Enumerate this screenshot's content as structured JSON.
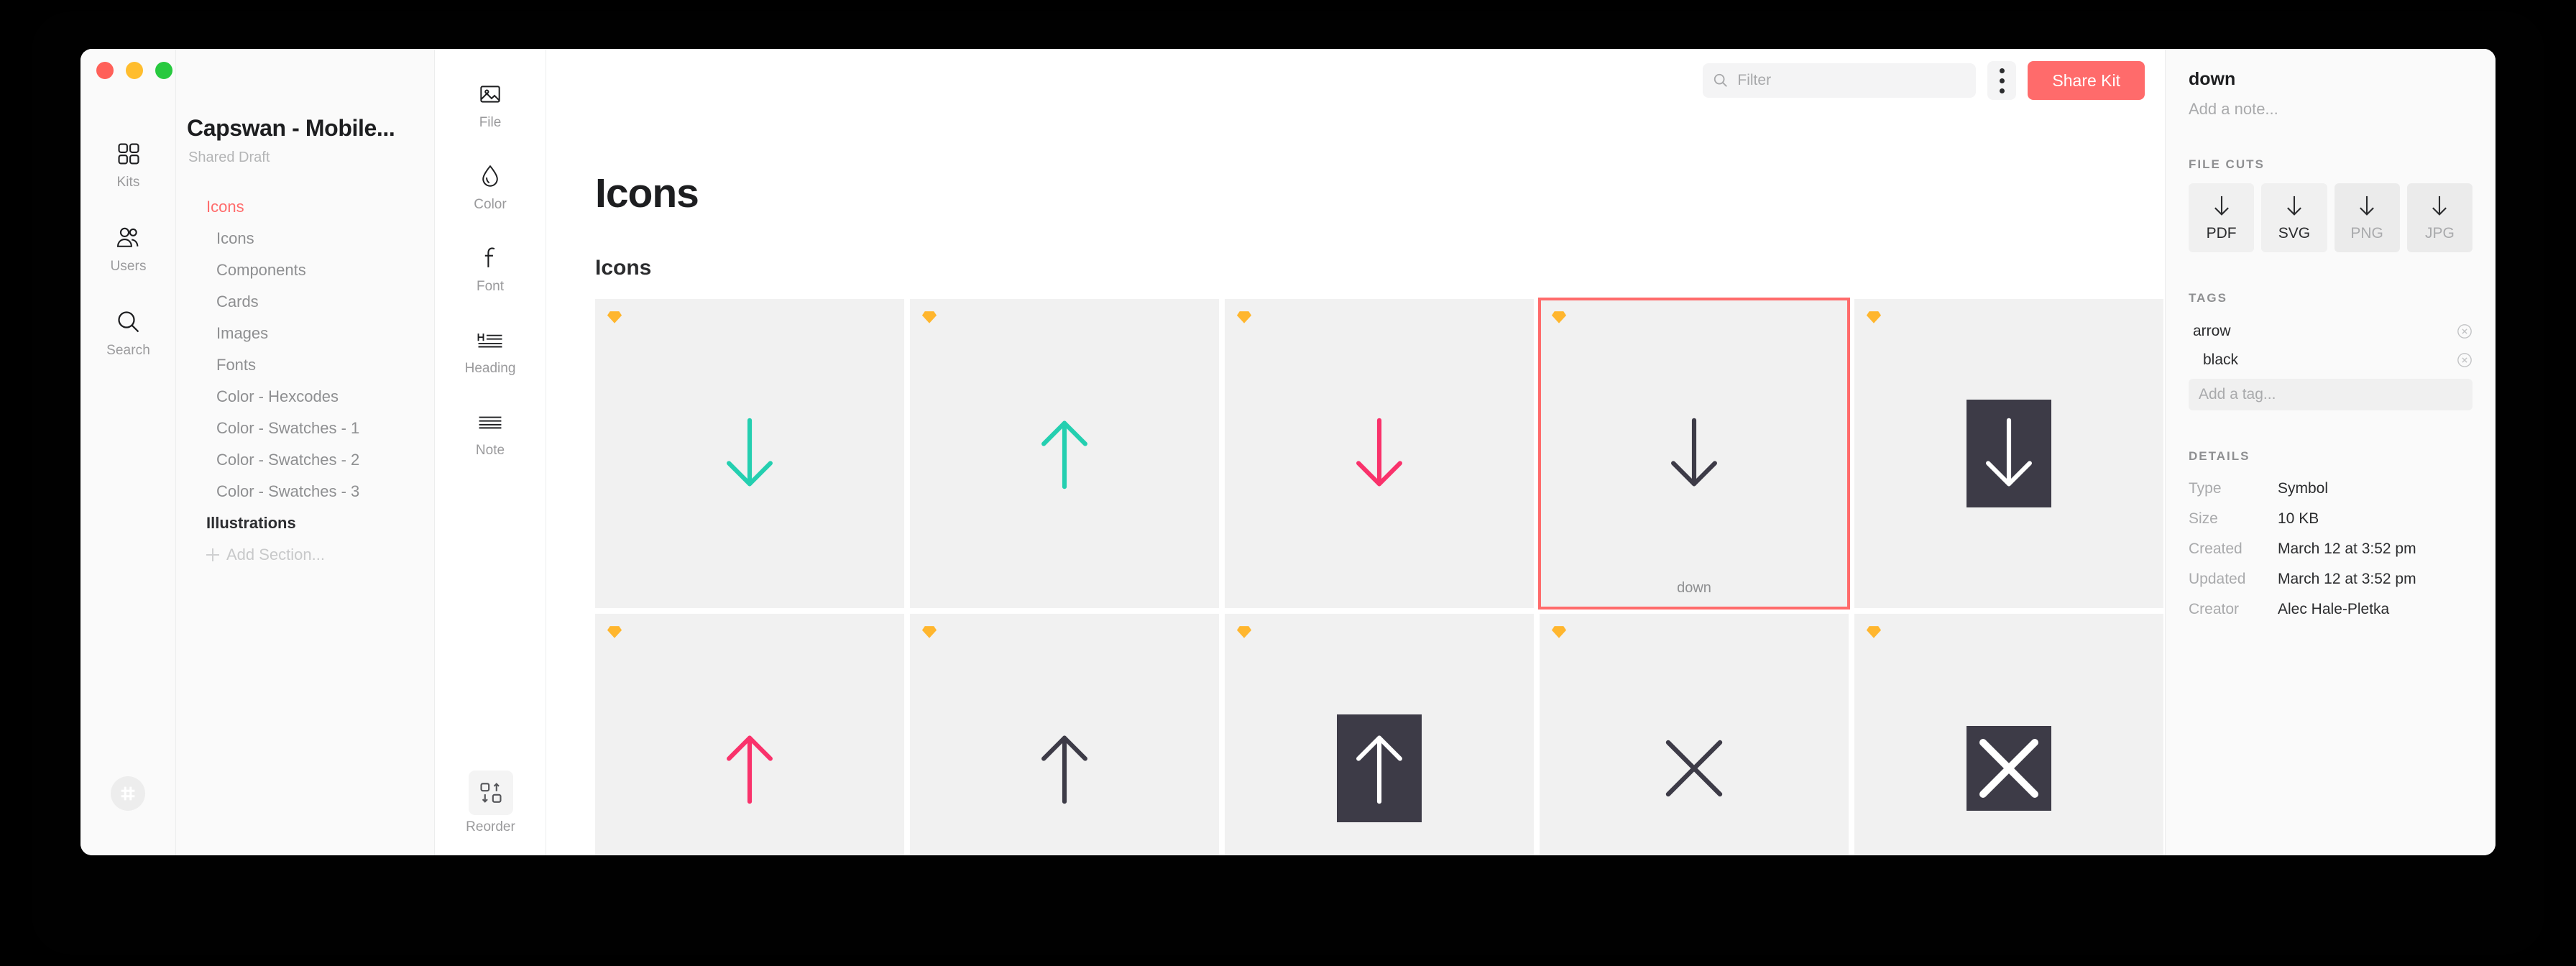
{
  "window": {
    "title": "Capswan - Mobile...",
    "subtitle": "Shared Draft"
  },
  "rail": {
    "items": [
      {
        "label": "Kits",
        "icon": "grid-icon"
      },
      {
        "label": "Users",
        "icon": "users-icon"
      },
      {
        "label": "Search",
        "icon": "search-icon"
      }
    ],
    "avatar_icon": "hash-avatar-icon"
  },
  "sidebar": {
    "sections": [
      {
        "label": "Icons",
        "style": "group"
      },
      {
        "label": "Icons",
        "style": "child"
      },
      {
        "label": "Components",
        "style": "child"
      },
      {
        "label": "Cards",
        "style": "child"
      },
      {
        "label": "Images",
        "style": "child"
      },
      {
        "label": "Fonts",
        "style": "child"
      },
      {
        "label": "Color - Hexcodes",
        "style": "child"
      },
      {
        "label": "Color - Swatches - 1",
        "style": "child"
      },
      {
        "label": "Color - Swatches - 2",
        "style": "child"
      },
      {
        "label": "Color - Swatches - 3",
        "style": "child"
      },
      {
        "label": "Illustrations",
        "style": "group2"
      }
    ],
    "add_section_label": "Add Section..."
  },
  "palette": {
    "tools": [
      {
        "label": "File",
        "icon": "image-file-icon"
      },
      {
        "label": "Color",
        "icon": "droplet-icon"
      },
      {
        "label": "Font",
        "icon": "font-f-icon"
      },
      {
        "label": "Heading",
        "icon": "heading-icon"
      },
      {
        "label": "Note",
        "icon": "note-lines-icon"
      }
    ],
    "reorder": {
      "label": "Reorder",
      "icon": "reorder-icon"
    }
  },
  "toolbar": {
    "filter_placeholder": "Filter",
    "filter_value": "",
    "filter_icon": "search-icon",
    "more_icon": "kebab-menu-icon",
    "share_label": "Share Kit",
    "accent_color": "#ff6b6b"
  },
  "main": {
    "page_title": "Icons",
    "section_title": "Icons",
    "tiles": [
      {
        "name": "",
        "art": "arrow-down",
        "color": "#24cfb0",
        "boxed": false,
        "selected": false,
        "badge": "sketch-diamond-icon"
      },
      {
        "name": "",
        "art": "arrow-up",
        "color": "#24cfb0",
        "boxed": false,
        "selected": false,
        "badge": "sketch-diamond-icon"
      },
      {
        "name": "",
        "art": "arrow-down",
        "color": "#f9326b",
        "boxed": false,
        "selected": false,
        "badge": "sketch-diamond-icon"
      },
      {
        "name": "down",
        "art": "arrow-down",
        "color": "#3d3b47",
        "boxed": false,
        "selected": true,
        "badge": "sketch-diamond-icon"
      },
      {
        "name": "",
        "art": "arrow-down",
        "color": "#ffffff",
        "boxed": true,
        "selected": false,
        "badge": "sketch-diamond-icon"
      },
      {
        "name": "",
        "art": "arrow-up",
        "color": "#f9326b",
        "boxed": false,
        "selected": false,
        "badge": "sketch-diamond-icon"
      },
      {
        "name": "",
        "art": "arrow-up",
        "color": "#3d3b47",
        "boxed": false,
        "selected": false,
        "badge": "sketch-diamond-icon"
      },
      {
        "name": "",
        "art": "arrow-up",
        "color": "#ffffff",
        "boxed": true,
        "selected": false,
        "badge": "sketch-diamond-icon"
      },
      {
        "name": "",
        "art": "close-x",
        "color": "#3d3b47",
        "boxed": false,
        "selected": false,
        "badge": "sketch-diamond-icon"
      },
      {
        "name": "",
        "art": "close-x",
        "color": "#ffffff",
        "boxed": true,
        "selected": false,
        "badge": "sketch-diamond-icon"
      }
    ]
  },
  "inspector": {
    "title": "down",
    "note_placeholder": "Add a note...",
    "file_cuts_heading": "FILE CUTS",
    "file_cuts": [
      {
        "label": "PDF",
        "enabled": true
      },
      {
        "label": "SVG",
        "enabled": true
      },
      {
        "label": "PNG",
        "enabled": false
      },
      {
        "label": "JPG",
        "enabled": false
      }
    ],
    "tags_heading": "TAGS",
    "tags": [
      "arrow",
      "black"
    ],
    "tag_placeholder": "Add a tag...",
    "details_heading": "DETAILS",
    "details": [
      {
        "key": "Type",
        "value": "Symbol"
      },
      {
        "key": "Size",
        "value": "10 KB"
      },
      {
        "key": "Created",
        "value": "March 12 at 3:52 pm"
      },
      {
        "key": "Updated",
        "value": "March 12 at 3:52 pm"
      },
      {
        "key": "Creator",
        "value": "Alec Hale-Pletka"
      }
    ]
  }
}
